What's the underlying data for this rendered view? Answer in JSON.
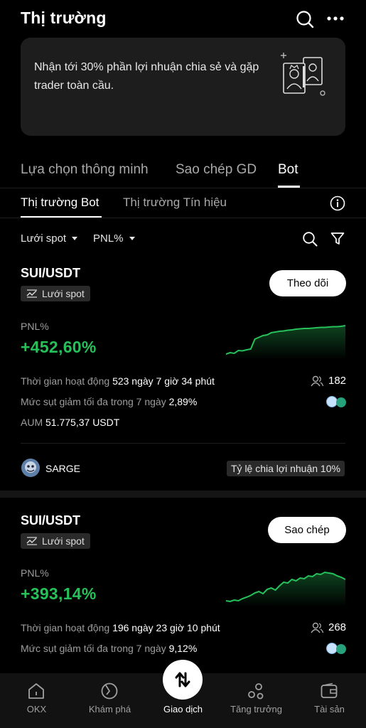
{
  "header": {
    "title": "Thị trường"
  },
  "promo": {
    "text": "Nhận tới 30% phần lợi nhuận chia sẻ và gặp trader toàn cầu."
  },
  "tabs": [
    {
      "label": "Lựa chọn thông minh",
      "active": false
    },
    {
      "label": "Sao chép GD",
      "active": false
    },
    {
      "label": "Bot",
      "active": true
    }
  ],
  "sub_tabs": [
    {
      "label": "Thị trường Bot",
      "active": true
    },
    {
      "label": "Thị trường Tín hiệu",
      "active": false
    }
  ],
  "filters": {
    "strategy": "Lưới spot",
    "sort": "PNL%"
  },
  "cards": [
    {
      "pair": "SUI/USDT",
      "tag": "Lưới spot",
      "button": "Theo dõi",
      "pnl_label": "PNL%",
      "pnl_value": "+452,60%",
      "runtime_label": "Thời gian hoạt động",
      "runtime_value": "523 ngày 7 giờ 34 phút",
      "followers": "182",
      "drawdown_label": "Mức sụt giảm tối đa trong 7 ngày",
      "drawdown_value": "2,89%",
      "aum_label": "AUM",
      "aum_value": "51.775,37 USDT",
      "creator": "SARGE",
      "share_ratio": "Tỷ lệ chia lợi nhuận 10%",
      "chart": [
        0.08,
        0.12,
        0.1,
        0.18,
        0.17,
        0.2,
        0.22,
        0.5,
        0.55,
        0.6,
        0.62,
        0.68,
        0.7,
        0.72,
        0.73,
        0.75,
        0.76,
        0.78,
        0.79,
        0.8,
        0.8,
        0.81,
        0.82,
        0.83,
        0.83,
        0.84,
        0.85,
        0.85,
        0.86,
        0.88
      ]
    },
    {
      "pair": "SUI/USDT",
      "tag": "Lưới spot",
      "button": "Sao chép",
      "pnl_label": "PNL%",
      "pnl_value": "+393,14%",
      "runtime_label": "Thời gian hoạt động",
      "runtime_value": "196 ngày 23 giờ 10 phút",
      "followers": "268",
      "drawdown_label": "Mức sụt giảm tối đa trong 7 ngày",
      "drawdown_value": "9,12%",
      "chart": [
        0.1,
        0.08,
        0.12,
        0.1,
        0.16,
        0.2,
        0.25,
        0.32,
        0.36,
        0.3,
        0.42,
        0.46,
        0.4,
        0.52,
        0.62,
        0.6,
        0.7,
        0.66,
        0.74,
        0.72,
        0.8,
        0.78,
        0.86,
        0.84,
        0.9,
        0.88,
        0.86,
        0.8,
        0.76,
        0.7
      ]
    }
  ],
  "nav": [
    {
      "label": "OKX",
      "icon": "home-icon",
      "active": false
    },
    {
      "label": "Khám phá",
      "icon": "discover-icon",
      "active": false
    },
    {
      "label": "Giao dịch",
      "icon": "trade-icon",
      "active": true
    },
    {
      "label": "Tăng trưởng",
      "icon": "growth-icon",
      "active": false
    },
    {
      "label": "Tài sản",
      "icon": "wallet-icon",
      "active": false
    }
  ],
  "colors": {
    "positive": "#26c15a",
    "background": "#000000",
    "card": "#1d1d1d"
  }
}
